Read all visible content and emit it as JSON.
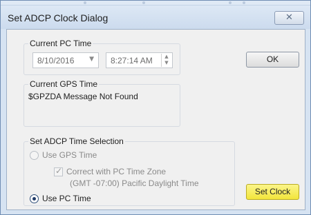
{
  "window": {
    "title": "Set ADCP Clock Dialog",
    "close_glyph": "✕"
  },
  "current_pc_time": {
    "group_label": "Current PC Time",
    "date_value": "8/10/2016",
    "time_value": "8:27:14 AM"
  },
  "current_gps_time": {
    "group_label": "Current GPS Time",
    "message": "$GPZDA Message Not Found"
  },
  "time_selection": {
    "group_label": "Set ADCP Time Selection",
    "use_gps_label": "Use GPS Time",
    "use_gps_selected": false,
    "correct_tz_label": "Correct with PC Time Zone",
    "correct_tz_checked": true,
    "tz_note": "(GMT -07:00) Pacific Daylight Time",
    "use_pc_label": "Use PC Time",
    "use_pc_selected": true
  },
  "buttons": {
    "ok_label": "OK",
    "set_clock_label": "Set Clock"
  },
  "icons": {
    "close": "close-icon",
    "dropdown": "chevron-down-icon",
    "spin": "spinner-arrows-icon",
    "check": "checkmark-icon"
  },
  "colors": {
    "title_bar": "#d6e3f2",
    "dialog_bg": "#f0f0f0",
    "highlight_button": "#f2e53b",
    "disabled_text": "#8a8a8a"
  }
}
